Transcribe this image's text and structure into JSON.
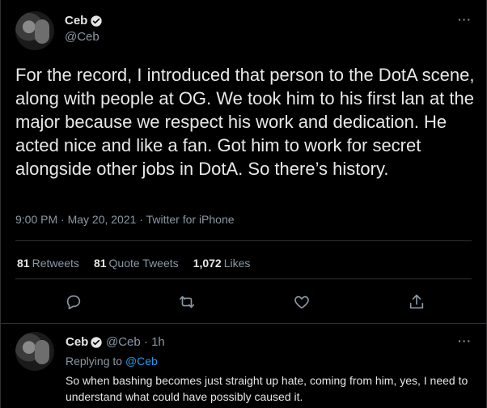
{
  "author": {
    "name": "Ceb",
    "handle": "@Ceb"
  },
  "tweet": {
    "text": "For the record, I introduced that person to the DotA scene, along with people at OG. We took him to his first lan at the major because we respect his work and dedication. He acted nice and like a fan. Got him to work for secret alongside other jobs in DotA. So there’s history.",
    "meta": "9:00 PM · May 20, 2021 · Twitter for iPhone"
  },
  "stats": {
    "retweets_count": "81",
    "retweets_label": "Retweets",
    "quote_count": "81",
    "quote_label": "Quote Tweets",
    "likes_count": "1,072",
    "likes_label": "Likes"
  },
  "actions": [
    "reply-icon",
    "retweet-icon",
    "like-icon",
    "share-icon"
  ],
  "reply": {
    "name": "Ceb",
    "handle": "@Ceb",
    "time": "· 1h",
    "replying_prefix": "Replying to",
    "replying_to": "@Ceb",
    "text": "So when bashing becomes just straight up hate, coming from him, yes, I need to understand what could have possibly caused it."
  },
  "more_label": "···",
  "colors": {
    "background": "#000000",
    "accent": "#1d9bf0",
    "muted": "#8b98a5",
    "divider": "#2f3336"
  }
}
